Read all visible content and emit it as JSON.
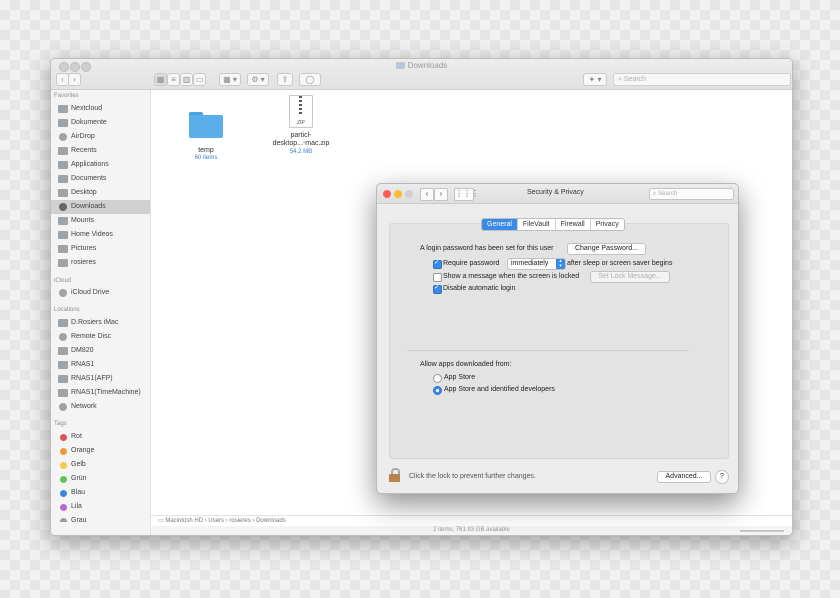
{
  "finder": {
    "title": "Downloads",
    "search_placeholder": "Search",
    "sidebar": {
      "favorites_header": "Favorites",
      "favorites": [
        "Nextcloud",
        "Dokumente",
        "AirDrop",
        "Recents",
        "Applications",
        "Documents",
        "Desktop",
        "Downloads",
        "Mounts",
        "Home Videos",
        "Pictures",
        "rosieres"
      ],
      "icloud_header": "iCloud",
      "icloud": [
        "iCloud Drive"
      ],
      "locations_header": "Locations",
      "locations": [
        "D.Rosiers iMac",
        "Remote Disc",
        "DM820",
        "RNAS1",
        "RNAS1(AFP)",
        "RNAS1(TimeMachine)",
        "Network"
      ],
      "tags_header": "Tags",
      "tags": [
        {
          "label": "Rot",
          "color": "#e0524f"
        },
        {
          "label": "Orange",
          "color": "#f09a37"
        },
        {
          "label": "Gelb",
          "color": "#f2cb45"
        },
        {
          "label": "Grün",
          "color": "#62c454"
        },
        {
          "label": "Blau",
          "color": "#3c88e0"
        },
        {
          "label": "Lila",
          "color": "#b56ad0"
        },
        {
          "label": "Grau",
          "color": "#9a9a9a"
        }
      ]
    },
    "files": [
      {
        "name": "temp",
        "sub": "60 items"
      },
      {
        "name_line1": "particl-",
        "name_line2": "desktop...-mac.zip",
        "sub": "54.2 MB",
        "badge": "ZIP"
      }
    ],
    "path": [
      "Macintosh HD",
      "Users",
      "rosieres",
      "Downloads"
    ],
    "status": "2 items, 761.93 GB available"
  },
  "security": {
    "title": "Security & Privacy",
    "search_placeholder": "Search",
    "tabs": [
      "General",
      "FileVault",
      "Firewall",
      "Privacy"
    ],
    "login_text": "A login password has been set for this user",
    "change_password": "Change Password...",
    "require_password": "Require password",
    "require_select": "immediately",
    "require_after": "after sleep or screen saver begins",
    "show_message": "Show a message when the screen is locked",
    "set_lock_message": "Set Lock Message...",
    "disable_auto_login": "Disable automatic login",
    "allow_apps": "Allow apps downloaded from:",
    "app_store": "App Store",
    "app_store_identified": "App Store and identified developers",
    "lock_text": "Click the lock to prevent further changes.",
    "advanced": "Advanced...",
    "help": "?"
  },
  "colors": {
    "accent": "#3a8ae8",
    "folder": "#5aaeea"
  }
}
